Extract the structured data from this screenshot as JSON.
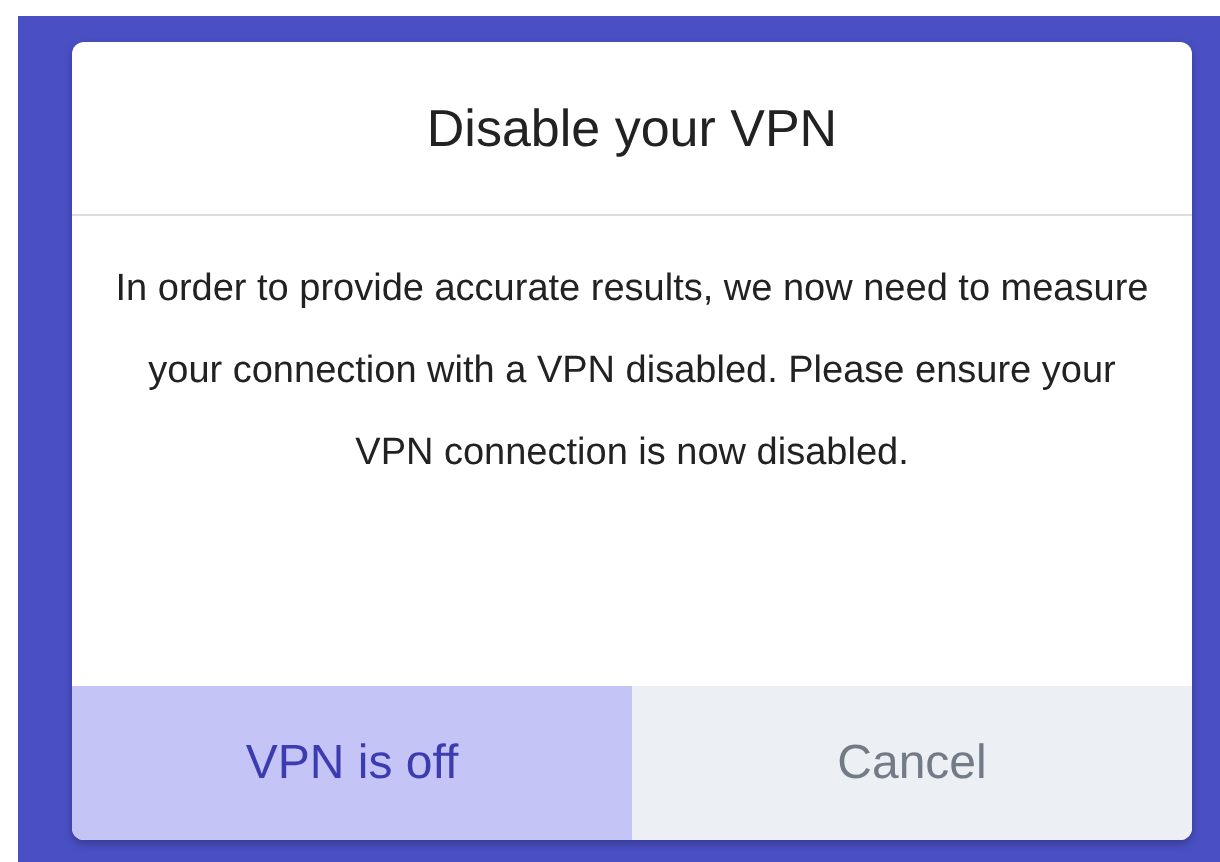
{
  "dialog": {
    "title": "Disable your VPN",
    "message": "In order to provide accurate results, we now need to measure your connection with a VPN disabled. Please ensure your VPN connection is now disabled.",
    "buttons": [
      {
        "label": "VPN is off",
        "kind": "primary"
      },
      {
        "label": "Cancel",
        "kind": "secondary"
      }
    ]
  }
}
